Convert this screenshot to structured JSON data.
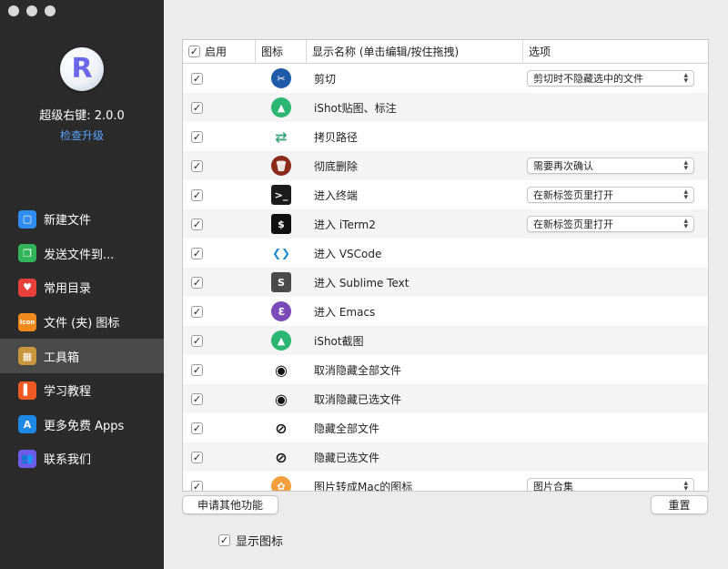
{
  "app": {
    "logo_letter": "R",
    "title": "超级右键: 2.0.0",
    "upgrade_link": "检查升级"
  },
  "sidebar": {
    "items": [
      {
        "label": "新建文件",
        "icon": "new-file-icon",
        "color": "#2f8cf0",
        "glyph": "▢"
      },
      {
        "label": "发送文件到...",
        "icon": "send-file-icon",
        "color": "#32b45a",
        "glyph": "❐"
      },
      {
        "label": "常用目录",
        "icon": "heart-icon",
        "color": "#e8413c",
        "glyph": "♥"
      },
      {
        "label": "文件 (夹) 图标",
        "icon": "icon-badge-icon",
        "color": "#f08a1c",
        "glyph": "Icon"
      },
      {
        "label": "工具箱",
        "icon": "toolbox-icon",
        "color": "#c9953e",
        "glyph": "▦",
        "active": true
      },
      {
        "label": "学习教程",
        "icon": "book-icon",
        "color": "#ee5a24",
        "glyph": "▌"
      },
      {
        "label": "更多免费 Apps",
        "icon": "app-store-icon",
        "color": "#1e88e5",
        "glyph": "A"
      },
      {
        "label": "联系我们",
        "icon": "contacts-icon",
        "color": "#6c5ce7",
        "glyph": "👥"
      }
    ]
  },
  "table": {
    "header": {
      "enabled": "启用",
      "icon": "图标",
      "name": "显示名称 (单击编辑/按住拖拽)",
      "options": "选项"
    },
    "rows": [
      {
        "name": "剪切",
        "icon": "cut-icon",
        "color": "#1e5aa8",
        "glyph": "✂",
        "option": "剪切时不隐藏选中的文件"
      },
      {
        "name": "iShot贴图、标注",
        "icon": "ishot-pin-icon",
        "color": "#2bb673",
        "glyph": "▲",
        "option": ""
      },
      {
        "name": "拷贝路径",
        "icon": "copy-path-icon",
        "color": "#7fc8a9",
        "glyph": "⇄",
        "option": ""
      },
      {
        "name": "彻底删除",
        "icon": "trash-icon",
        "color": "#8b2a1a",
        "glyph": "🗑",
        "option": "需要再次确认"
      },
      {
        "name": "进入终端",
        "icon": "terminal-icon",
        "color": "#1c1c1c",
        "glyph": ">_",
        "option": "在新标签页里打开"
      },
      {
        "name": "进入 iTerm2",
        "icon": "iterm2-icon",
        "color": "#111111",
        "glyph": "$",
        "option": "在新标签页里打开"
      },
      {
        "name": "进入 VSCode",
        "icon": "vscode-icon",
        "color": "#1f8ad2",
        "glyph": "❮❯",
        "option": ""
      },
      {
        "name": "进入 Sublime Text",
        "icon": "sublime-icon",
        "color": "#4b4b4b",
        "glyph": "S",
        "option": ""
      },
      {
        "name": "进入 Emacs",
        "icon": "emacs-icon",
        "color": "#7b4ab8",
        "glyph": "ℇ",
        "option": ""
      },
      {
        "name": "iShot截图",
        "icon": "ishot-capture-icon",
        "color": "#2bb673",
        "glyph": "▲",
        "option": ""
      },
      {
        "name": "取消隐藏全部文件",
        "icon": "eye-icon",
        "color": "#111111",
        "glyph": "◉",
        "option": ""
      },
      {
        "name": "取消隐藏已选文件",
        "icon": "eye-icon",
        "color": "#111111",
        "glyph": "◉",
        "option": ""
      },
      {
        "name": "隐藏全部文件",
        "icon": "eye-slash-icon",
        "color": "#111111",
        "glyph": "⊘",
        "option": ""
      },
      {
        "name": "隐藏已选文件",
        "icon": "eye-slash-icon",
        "color": "#111111",
        "glyph": "⊘",
        "option": ""
      },
      {
        "name": "图片转成Mac的图标",
        "icon": "photos-icon",
        "color": "#f2a03d",
        "glyph": "✿",
        "option": "图片合集"
      }
    ]
  },
  "buttons": {
    "request": "申请其他功能",
    "reset": "重置"
  },
  "show_icon_label": "显示图标"
}
